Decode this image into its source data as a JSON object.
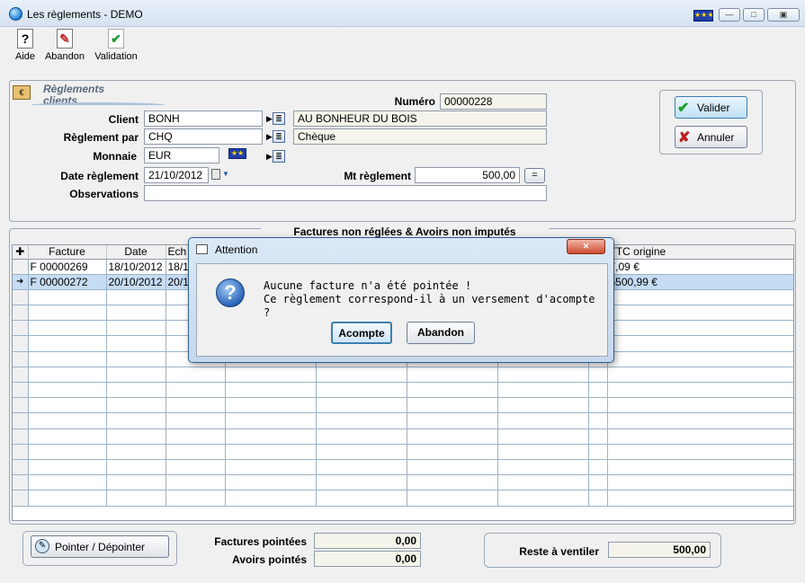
{
  "window": {
    "title": "Les règlements - DEMO",
    "close_glyph": "✕"
  },
  "toolbar": {
    "items": [
      {
        "label": "Aide",
        "icon": "help-icon",
        "glyph": "?"
      },
      {
        "label": "Abandon",
        "icon": "abandon-icon",
        "glyph": "✎"
      },
      {
        "label": "Validation",
        "icon": "validation-icon",
        "glyph": "✔"
      }
    ]
  },
  "header": {
    "logo_line1": "Règlements",
    "logo_line2": "clients"
  },
  "form": {
    "numero_label": "Numéro",
    "numero": "00000228",
    "client_label": "Client",
    "client_code": "BONH",
    "client_name": "AU BONHEUR DU BOIS",
    "reglement_label": "Règlement par",
    "reglement_code": "CHQ",
    "reglement_name": "Chèque",
    "monnaie_label": "Monnaie",
    "monnaie": "EUR",
    "date_label": "Date règlement",
    "date": "21/10/2012",
    "mt_label": "Mt règlement",
    "mt": "500,00",
    "eq_button": "=",
    "obs_label": "Observations",
    "obs": ""
  },
  "actions": {
    "valider": "Valider",
    "annuler": "Annuler"
  },
  "grid": {
    "title": "Factures non réglées & Avoirs non imputés",
    "columns": [
      "Facture",
      "Date",
      "Ech",
      "",
      "",
      "",
      "",
      "",
      "TTC origine"
    ],
    "rows": [
      {
        "marker": "",
        "facture": "F 00000269",
        "date": "18/10/2012",
        "ech": "18/1",
        "ttc": "7,09 €"
      },
      {
        "marker": "➜",
        "facture": "F 00000272",
        "date": "20/10/2012",
        "ech": "20/1",
        "ttc": "5500,99 €"
      }
    ]
  },
  "bottom": {
    "pointer_button": "Pointer / Dépointer",
    "factures_label": "Factures pointées",
    "factures_value": "0,00",
    "avoirs_label": "Avoirs pointés",
    "avoirs_value": "0,00",
    "reste_label": "Reste à ventiler",
    "reste_value": "500,00"
  },
  "dialog": {
    "title": "Attention",
    "line1": "Aucune facture n'a été pointée !",
    "line2": "Ce règlement correspond-il à un versement d'acompte ?",
    "acompte": "Acompte",
    "abandon": "Abandon",
    "close_glyph": "✕"
  }
}
